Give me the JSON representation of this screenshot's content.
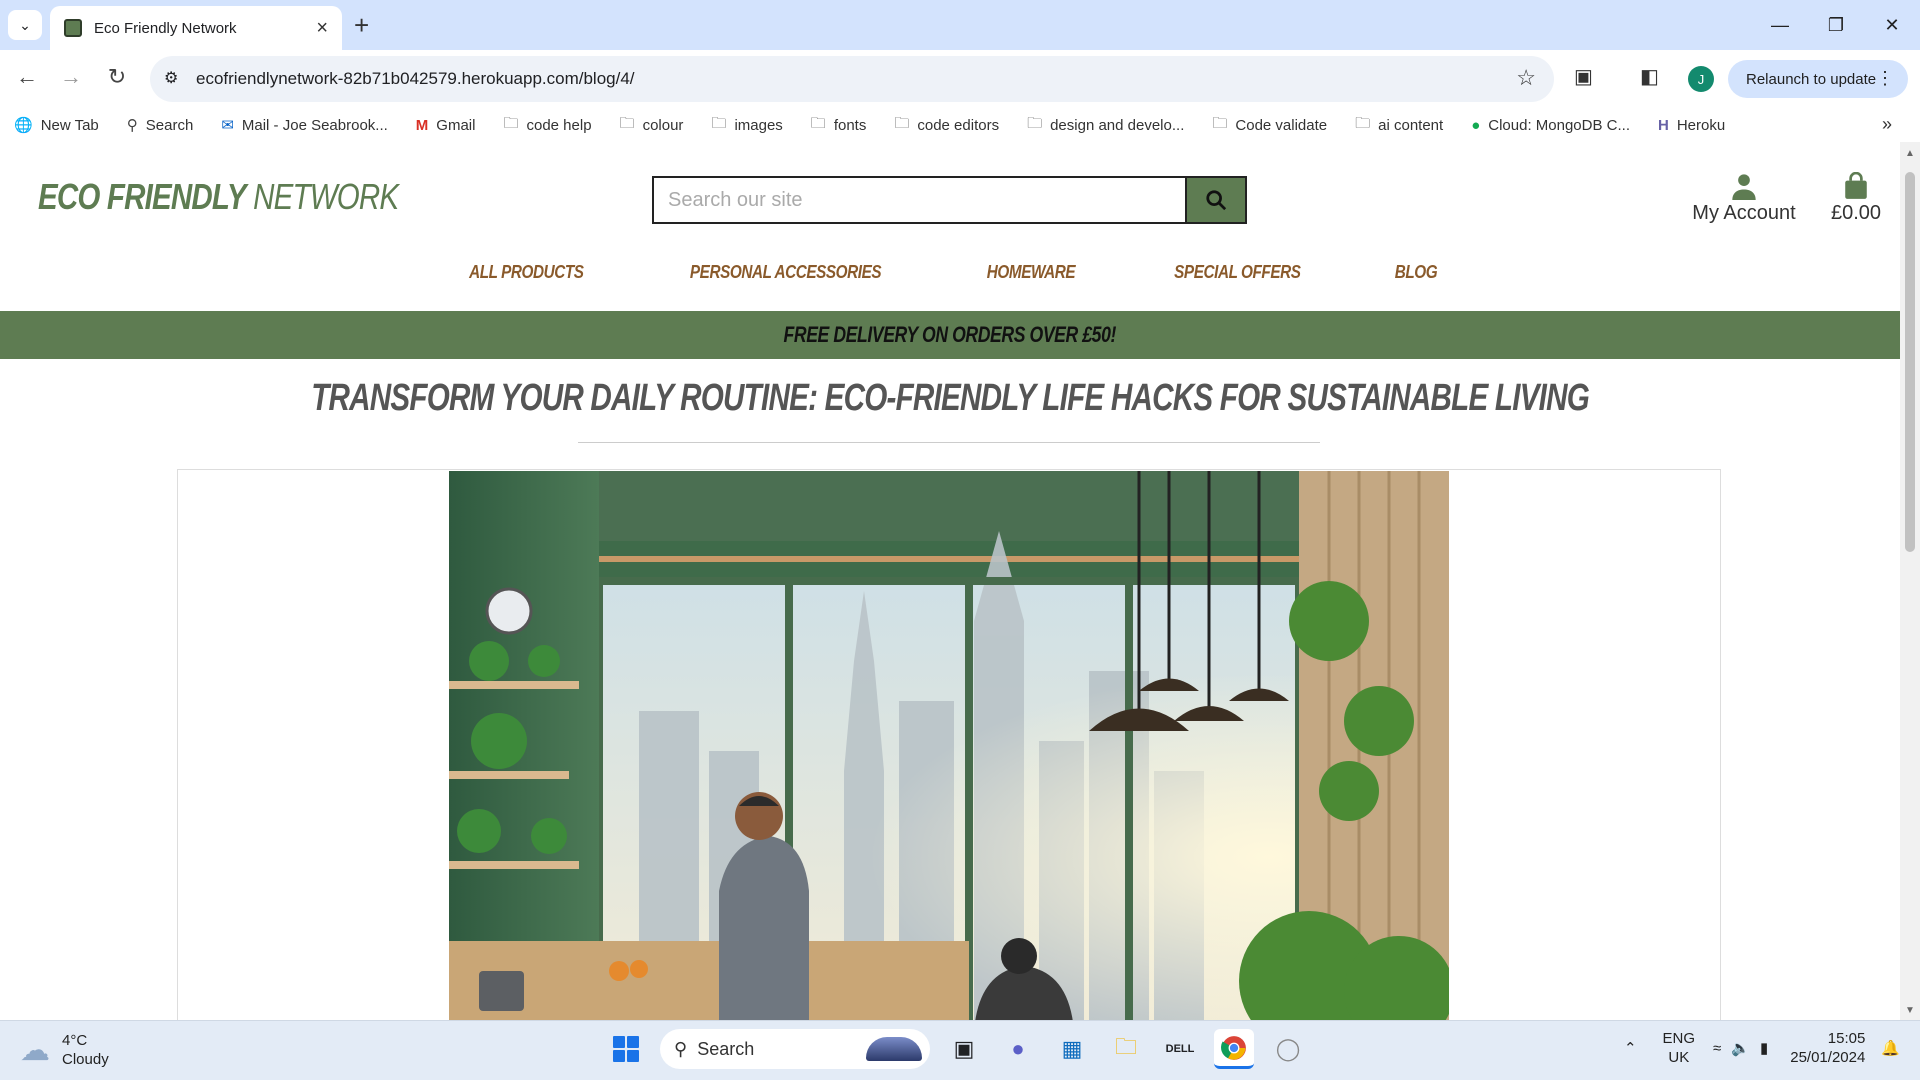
{
  "browser": {
    "tab_title": "Eco Friendly Network",
    "url": "ecofriendlynetwork-82b71b042579.herokuapp.com/blog/4/",
    "relaunch_label": "Relaunch to update",
    "profile_initial": "J",
    "bookmarks": [
      {
        "label": "New Tab",
        "icon": "globe-icon"
      },
      {
        "label": "Search",
        "icon": "search-icon"
      },
      {
        "label": "Mail - Joe Seabrook...",
        "icon": "outlook-icon"
      },
      {
        "label": "Gmail",
        "icon": "gmail-icon"
      },
      {
        "label": "code help",
        "icon": "folder-icon"
      },
      {
        "label": "colour",
        "icon": "folder-icon"
      },
      {
        "label": "images",
        "icon": "folder-icon"
      },
      {
        "label": "fonts",
        "icon": "folder-icon"
      },
      {
        "label": "code editors",
        "icon": "folder-icon"
      },
      {
        "label": "design and develo...",
        "icon": "folder-icon"
      },
      {
        "label": "Code validate",
        "icon": "folder-icon"
      },
      {
        "label": "ai content",
        "icon": "folder-icon"
      },
      {
        "label": "Cloud: MongoDB C...",
        "icon": "mongodb-icon"
      },
      {
        "label": "Heroku",
        "icon": "heroku-icon"
      }
    ]
  },
  "site": {
    "logo_bold": "ECO FRIENDLY",
    "logo_light": "NETWORK",
    "search_placeholder": "Search our site",
    "account_label": "My Account",
    "bag_total": "£0.00",
    "nav": [
      "ALL PRODUCTS",
      "PERSONAL ACCESSORIES",
      "HOMEWARE",
      "SPECIAL OFFERS",
      "BLOG"
    ],
    "promo": "FREE DELIVERY ON ORDERS OVER £50!",
    "post_title": "TRANSFORM YOUR DAILY ROUTINE: ECO-FRIENDLY LIFE HACKS FOR SUSTAINABLE LIVING"
  },
  "taskbar": {
    "temperature": "4°C",
    "condition": "Cloudy",
    "search_label": "Search",
    "lang_1": "ENG",
    "lang_2": "UK",
    "time": "15:05",
    "date": "25/01/2024"
  },
  "colors": {
    "brand_green": "#5e7c52",
    "nav_brown": "#8a5a2b"
  }
}
